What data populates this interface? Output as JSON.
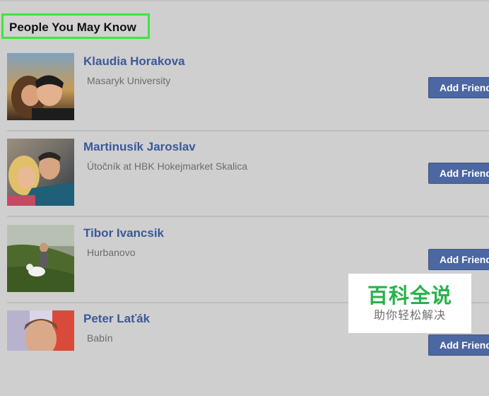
{
  "section": {
    "title": "People You May Know"
  },
  "people": [
    {
      "name": "Klaudia Horakova",
      "detail": "Masaryk University",
      "button_label": "Add Friend"
    },
    {
      "name": "Martinusík Jaroslav",
      "detail": "Útočník at HBK Hokejmarket Skalica",
      "button_label": "Add Friend"
    },
    {
      "name": "Tibor Ivancsik",
      "detail": "Hurbanovo",
      "button_label": "Add Friend"
    },
    {
      "name": "Peter Laťák",
      "detail": "Babín",
      "button_label": "Add Friend"
    }
  ],
  "watermark": {
    "main": "百科全说",
    "sub": "助你轻松解决"
  },
  "colors": {
    "page_background": "#cfcfcf",
    "name_link": "#3b5998",
    "button": "#4c67a1",
    "highlight_border": "#3ee63b",
    "watermark_green": "#27b34a"
  }
}
